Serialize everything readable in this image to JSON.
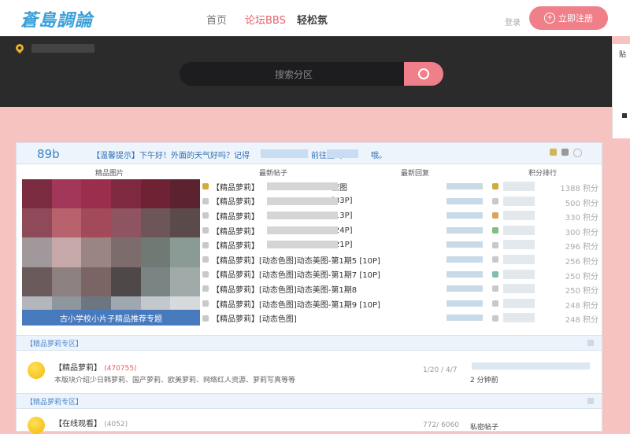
{
  "header": {
    "logo": "蒼島調論",
    "nav": [
      {
        "label": "首页",
        "state": "normal"
      },
      {
        "label": "论坛BBS",
        "state": "active"
      },
      {
        "label": "轻松氛",
        "state": "bold"
      }
    ],
    "signin": "登录",
    "signup": "立即注册",
    "accent": "#ef7f88"
  },
  "band": {
    "search_placeholder": "搜索分区",
    "side_label": "贴"
  },
  "notice": {
    "date_num": "89b",
    "text": "【温馨提示】下午好！外面的天气好吗？记得",
    "text_tail": "前往签到",
    "text_end": "哦。"
  },
  "columns": {
    "photo": "精品图片",
    "threads": "最新帖子",
    "replies": "最新回复",
    "ranking": "积分排行"
  },
  "photo_caption": "古小学校小片子精品推荐专题",
  "threads": [
    {
      "tag": "【精品萝莉】",
      "suffix": "套图",
      "gold": true
    },
    {
      "tag": "【精品萝莉】",
      "suffix": "[33P]",
      "gold": false
    },
    {
      "tag": "【精品萝莉】",
      "suffix": "[13P]",
      "gold": false
    },
    {
      "tag": "【精品萝莉】",
      "suffix": "[24P]",
      "gold": false
    },
    {
      "tag": "【精品萝莉】",
      "suffix": "[21P]",
      "gold": false
    },
    {
      "tag": "【精品萝莉】",
      "suffix": "[动态色图]动态美图-第1期5 [10P]",
      "gold": false
    },
    {
      "tag": "【精品萝莉】",
      "suffix": "[动态色图]动态美图-第1期7 [10P]",
      "gold": false
    },
    {
      "tag": "【精品萝莉】",
      "suffix": "[动态色图]动态美图-第1期8",
      "gold": false
    },
    {
      "tag": "【精品萝莉】",
      "suffix": "[动态色图]动态美图-第1期9 [10P]",
      "gold": false
    },
    {
      "tag": "【精品萝莉】",
      "suffix": "[动态色图]",
      "gold": false
    }
  ],
  "ranking": [
    {
      "score": "1388 积分",
      "color": "#d2aa3d"
    },
    {
      "score": "500 积分",
      "color": "#c9c9c9"
    },
    {
      "score": "330 积分",
      "color": "#d9a45f"
    },
    {
      "score": "300 积分",
      "color": "#7fbf7f"
    },
    {
      "score": "296 积分",
      "color": "#c9c9c9"
    },
    {
      "score": "256 积分",
      "color": "#c9c9c9"
    },
    {
      "score": "250 积分",
      "color": "#7fbfb0"
    },
    {
      "score": "250 积分",
      "color": "#c9c9c9"
    },
    {
      "score": "248 积分",
      "color": "#c9c9c9"
    },
    {
      "score": "248 积分",
      "color": "#c9c9c9"
    }
  ],
  "sections": [
    {
      "head": "【精品萝莉专区】",
      "forum_title": "【精品萝莉】",
      "forum_count": "(470755)",
      "forum_desc": "本版块介绍少日韩萝莉、国产萝莉、欧美萝莉、网络红人资源、萝莉写真等等",
      "forum_stat": "1/20 / 4/7",
      "forum_last": "2 分钟前"
    },
    {
      "head": "【精品萝莉专区】",
      "forum_title": "【在线观看】",
      "forum_count": "(4052)",
      "forum_desc": "",
      "forum_stat": "772/ 6060",
      "forum_last": "私密帖子"
    }
  ]
}
